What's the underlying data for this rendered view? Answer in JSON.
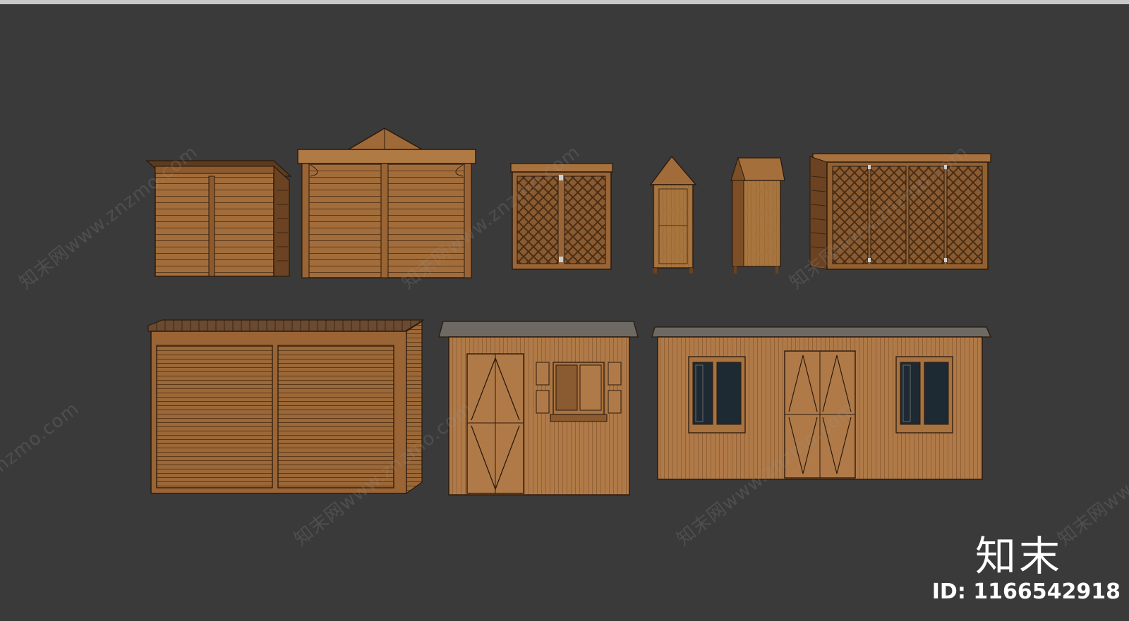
{
  "colors": {
    "background": "#3a3a3a",
    "wood_light": "#b17a45",
    "wood_mid": "#9a6636",
    "wood_dark": "#6a4220",
    "outline": "#2a1a0e",
    "roof_gray": "#6e6a63",
    "glass": "#1e2a33",
    "text": "#ffffff"
  },
  "watermark": {
    "text": "知末网www.znzmo.com"
  },
  "brand": {
    "logo_text": "知末",
    "id_text": "ID: 1166542918"
  },
  "models": [
    {
      "name": "slatted-shed-small"
    },
    {
      "name": "gable-pergola-shed"
    },
    {
      "name": "lattice-cabinet"
    },
    {
      "name": "tall-narrow-shed"
    },
    {
      "name": "gable-storage-box"
    },
    {
      "name": "lattice-wide-shed"
    },
    {
      "name": "roller-door-shed"
    },
    {
      "name": "cabin-with-window"
    },
    {
      "name": "long-cabin-two-windows"
    }
  ]
}
